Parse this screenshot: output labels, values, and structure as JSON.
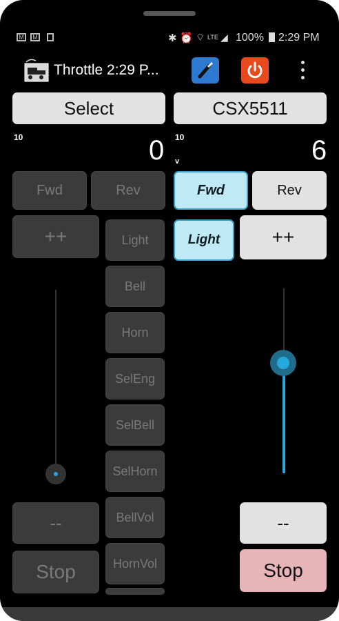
{
  "status_bar": {
    "battery": "100%",
    "time": "2:29 PM",
    "left_icons": [
      "mail-icon",
      "mail-icon",
      "sim-icon"
    ],
    "right_icons": [
      "bluetooth-icon",
      "alarm-icon",
      "wifi-icon",
      "lte-icon",
      "signal-icon",
      "battery-icon"
    ]
  },
  "app_bar": {
    "title": "Throttle  2:29 P...",
    "actions": [
      "power-button-icon",
      "power-icon",
      "overflow-menu-icon"
    ],
    "power_button_color": "#2e7ad1",
    "power_icon_color": "#e8491d"
  },
  "throttle_left": {
    "select_label": "Select",
    "speed_steps": "10",
    "speed": "0",
    "fwd_label": "Fwd",
    "rev_label": "Rev",
    "plus_label": "++",
    "minus_label": "--",
    "stop_label": "Stop",
    "functions": [
      "Light",
      "Bell",
      "Horn",
      "SelEng",
      "SelBell",
      "SelHorn",
      "BellVol",
      "HornVol"
    ],
    "slider_level": 0
  },
  "throttle_right": {
    "select_label": "CSX5511",
    "speed_steps": "10",
    "speed_unit": "v",
    "speed": "6",
    "fwd_label": "Fwd",
    "rev_label": "Rev",
    "light_label": "Light",
    "plus_label": "++",
    "minus_label": "--",
    "stop_label": "Stop",
    "slider_level": 0.6,
    "accent_color": "#27a8dd",
    "stop_color": "#e7b4b8"
  }
}
